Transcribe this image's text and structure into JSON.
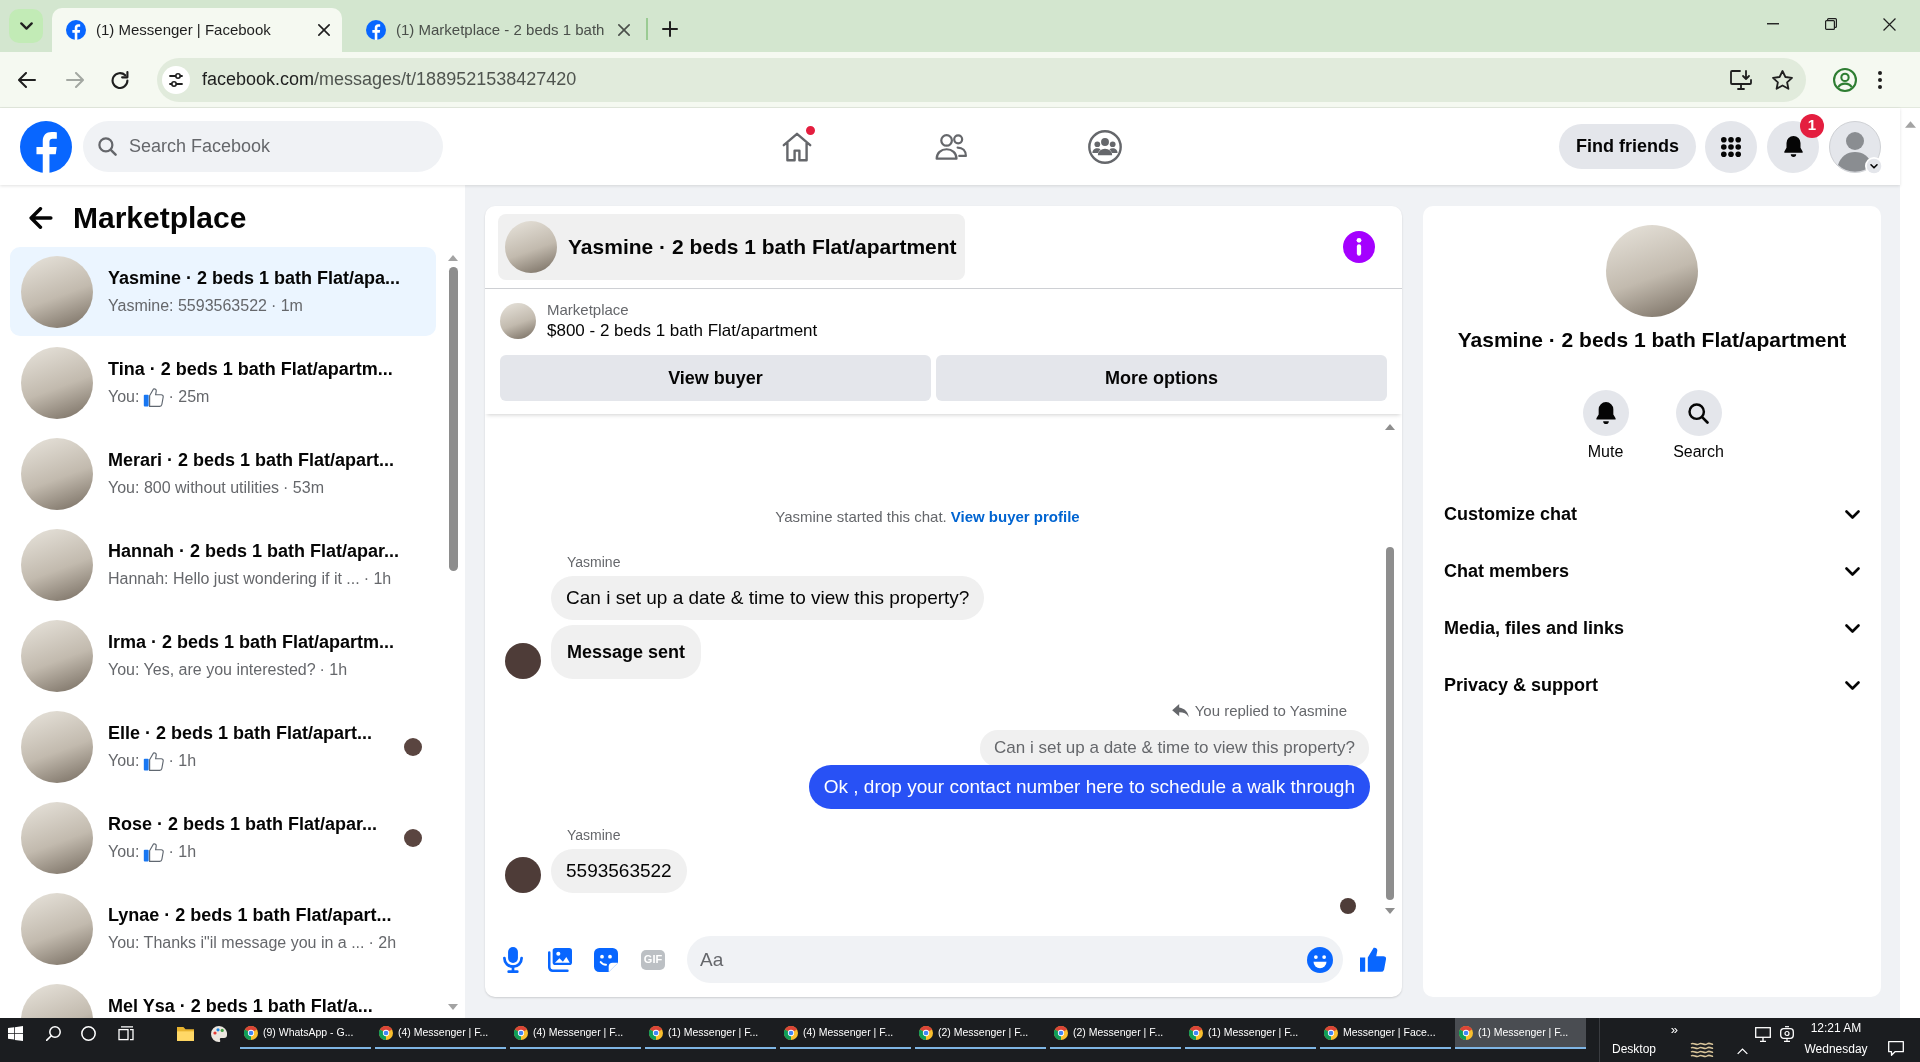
{
  "browser": {
    "tabs": [
      {
        "title": "(1) Messenger | Facebook",
        "selected": true
      },
      {
        "title": "(1) Marketplace - 2 beds 1 bath",
        "selected": false
      }
    ],
    "address": {
      "host": "facebook.com",
      "path": "/messages/t/1889521538427420"
    }
  },
  "header": {
    "search": {
      "placeholder": "Search Facebook"
    },
    "nav": [
      {
        "kind": "home",
        "dot": true
      },
      {
        "kind": "friends",
        "dot": false
      },
      {
        "kind": "groups",
        "dot": false
      }
    ],
    "find_friends": "Find friends",
    "notifications": {
      "count": "1"
    }
  },
  "sidebar": {
    "title": "Marketplace",
    "conversations": [
      {
        "name": "Yasmine · 2 beds 1 bath Flat/apa...",
        "preview": "Yasmine: 5593563522",
        "time": "· 1m",
        "kind": "text",
        "selected": true,
        "seen": false
      },
      {
        "name": "Tina · 2 beds 1 bath Flat/apartm...",
        "preview": "You:",
        "time": "· 25m",
        "kind": "like",
        "selected": false,
        "seen": false
      },
      {
        "name": "Merari · 2 beds 1 bath Flat/apart...",
        "preview": "You: 800 without utilities",
        "time": "· 53m",
        "kind": "text",
        "selected": false,
        "seen": false
      },
      {
        "name": "Hannah · 2 beds 1 bath Flat/apar...",
        "preview": "Hannah: Hello just wondering if it ...",
        "time": "· 1h",
        "kind": "text",
        "selected": false,
        "seen": false
      },
      {
        "name": "Irma · 2 beds 1 bath Flat/apartm...",
        "preview": "You: Yes, are you interested?",
        "time": "· 1h",
        "kind": "text",
        "selected": false,
        "seen": false
      },
      {
        "name": "Elle · 2 beds 1 bath Flat/apart...",
        "preview": "You:",
        "time": "· 1h",
        "kind": "like",
        "selected": false,
        "seen": true
      },
      {
        "name": "Rose · 2 beds 1 bath Flat/apar...",
        "preview": "You:",
        "time": "· 1h",
        "kind": "like",
        "selected": false,
        "seen": true
      },
      {
        "name": "Lynae · 2 beds 1 bath Flat/apart...",
        "preview": "You: Thanks i\"il message you in a ...",
        "time": "· 2h",
        "kind": "text",
        "selected": false,
        "seen": false
      },
      {
        "name": "Mel Ysa · 2 beds 1 bath Flat/a...",
        "kind": "text",
        "selected": false,
        "seen": false
      }
    ]
  },
  "chat": {
    "title": "Yasmine · 2 beds 1 bath Flat/apartment",
    "listing": {
      "source": "Marketplace",
      "title": "$800 - 2 beds 1 bath Flat/apartment"
    },
    "actions": [
      {
        "kind": "view_buyer",
        "label": "View buyer"
      },
      {
        "kind": "more_options",
        "label": "More options"
      }
    ],
    "messages": [
      {
        "kind": "system",
        "text": "Yasmine started this chat.",
        "link": "View buyer profile"
      },
      {
        "kind": "sender",
        "text": "Yasmine"
      },
      {
        "kind": "incoming",
        "text": "Can i set up a date & time to view this property?",
        "bold": false,
        "avatar": false
      },
      {
        "kind": "incoming",
        "text": "Message sent",
        "bold": true,
        "avatar": true
      },
      {
        "kind": "reply_note",
        "text": "You replied to Yasmine"
      },
      {
        "kind": "quote",
        "text": "Can i set up a date & time to view this property?"
      },
      {
        "kind": "outgoing",
        "text": "Ok , drop your contact number here to schedule a walk through"
      },
      {
        "kind": "sender",
        "text": "Yasmine"
      },
      {
        "kind": "incoming",
        "text": "5593563522",
        "bold": false,
        "avatar": true
      },
      {
        "kind": "read_receipt"
      }
    ],
    "composer": {
      "tools": [
        {
          "kind": "mic",
          "disabled": false
        },
        {
          "kind": "photo",
          "disabled": false
        },
        {
          "kind": "sticker",
          "disabled": false
        },
        {
          "kind": "gif",
          "label": "GIF",
          "disabled": true
        }
      ],
      "placeholder": "Aa"
    }
  },
  "details": {
    "title": "Yasmine · 2 beds 1 bath Flat/apartment",
    "actions": [
      {
        "kind": "mute",
        "label": "Mute"
      },
      {
        "kind": "search",
        "label": "Search"
      }
    ],
    "sections": [
      {
        "label": "Customize chat",
        "expanded": false
      },
      {
        "label": "Chat members",
        "expanded": false
      },
      {
        "label": "Media, files and links",
        "expanded": false
      },
      {
        "label": "Privacy & support",
        "expanded": false
      }
    ]
  },
  "taskbar": {
    "pinned": [
      {
        "kind": "file_explorer"
      },
      {
        "kind": "paint"
      }
    ],
    "windows": [
      {
        "label": "(9) WhatsApp - G...",
        "selected": false
      },
      {
        "label": "(4) Messenger | F...",
        "selected": false
      },
      {
        "label": "(4) Messenger | F...",
        "selected": false
      },
      {
        "label": "(1) Messenger | F...",
        "selected": false
      },
      {
        "label": "(4) Messenger | F...",
        "selected": false
      },
      {
        "label": "(2) Messenger | F...",
        "selected": false
      },
      {
        "label": "(2) Messenger | F...",
        "selected": false
      },
      {
        "label": "(1) Messenger | F...",
        "selected": false
      },
      {
        "label": "Messenger | Face...",
        "selected": false
      },
      {
        "label": "(1) Messenger | F...",
        "selected": true
      }
    ],
    "overflow": "»",
    "desktop": "Desktop",
    "time": "12:21 AM",
    "day": "Wednesday"
  }
}
